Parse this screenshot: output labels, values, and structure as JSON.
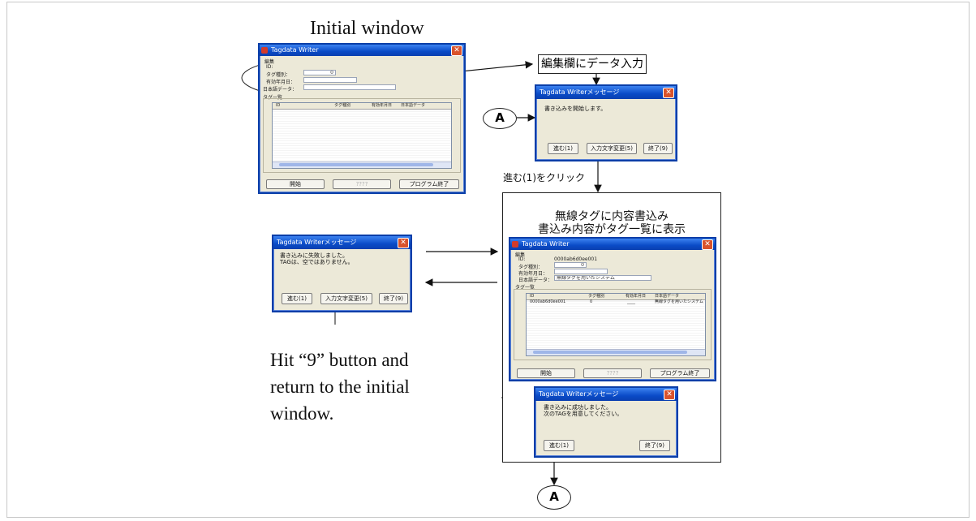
{
  "labels": {
    "initial_window": "Initial window",
    "edit_input": "編集欄にデータ入力",
    "click_proceed": "進む(1)をクリック",
    "result_line1": "無線タグに内容書込み",
    "result_line2": "書込み内容がタグ一覧に表示",
    "instruction_line1": "Hit “9” button and",
    "instruction_line2": "return to the initial",
    "instruction_line3": "window.",
    "connector": "A"
  },
  "main_window": {
    "title": "Tagdata Writer",
    "edit_group": "編集",
    "id_label": "ID:",
    "tag_type_label": "タグ種別：",
    "tag_type_value": "0",
    "expiry_label": "有効年月日：",
    "japanese_label": "日本語データ：",
    "tag_list_group": "タグ一覧",
    "columns": [
      "ID",
      "タグ種別",
      "有効年月日",
      "日本語データ"
    ],
    "buttons": {
      "start": "開始",
      "middle": "????",
      "exit": "プログラム終了"
    }
  },
  "result_window": {
    "title": "Tagdata Writer",
    "id_value": "0000ab6d0ee001",
    "tag_type_value": "0",
    "japanese_value": "無線タグを用いたシステム",
    "row": [
      "0000ab6d0ee001",
      "0",
      "____",
      "無線タグを用いたシステム"
    ]
  },
  "msg_start": {
    "title": "Tagdata Writerメッセージ",
    "text": "書き込みを開始します。",
    "buttons": [
      "進む(1)",
      "入力文字変更(5)",
      "終了(9)"
    ]
  },
  "msg_fail": {
    "title": "Tagdata Writerメッセージ",
    "line1": "書き込みに失敗しました。",
    "line2": "TAGは、空ではありません。",
    "buttons": [
      "進む(1)",
      "入力文字変更(5)",
      "終了(9)"
    ]
  },
  "msg_success": {
    "title": "Tagdata Writerメッセージ",
    "line1": "書き込みに成功しました。",
    "line2": "次のTAGを用意してください。",
    "buttons": [
      "進む(1)",
      "終了(9)"
    ]
  }
}
